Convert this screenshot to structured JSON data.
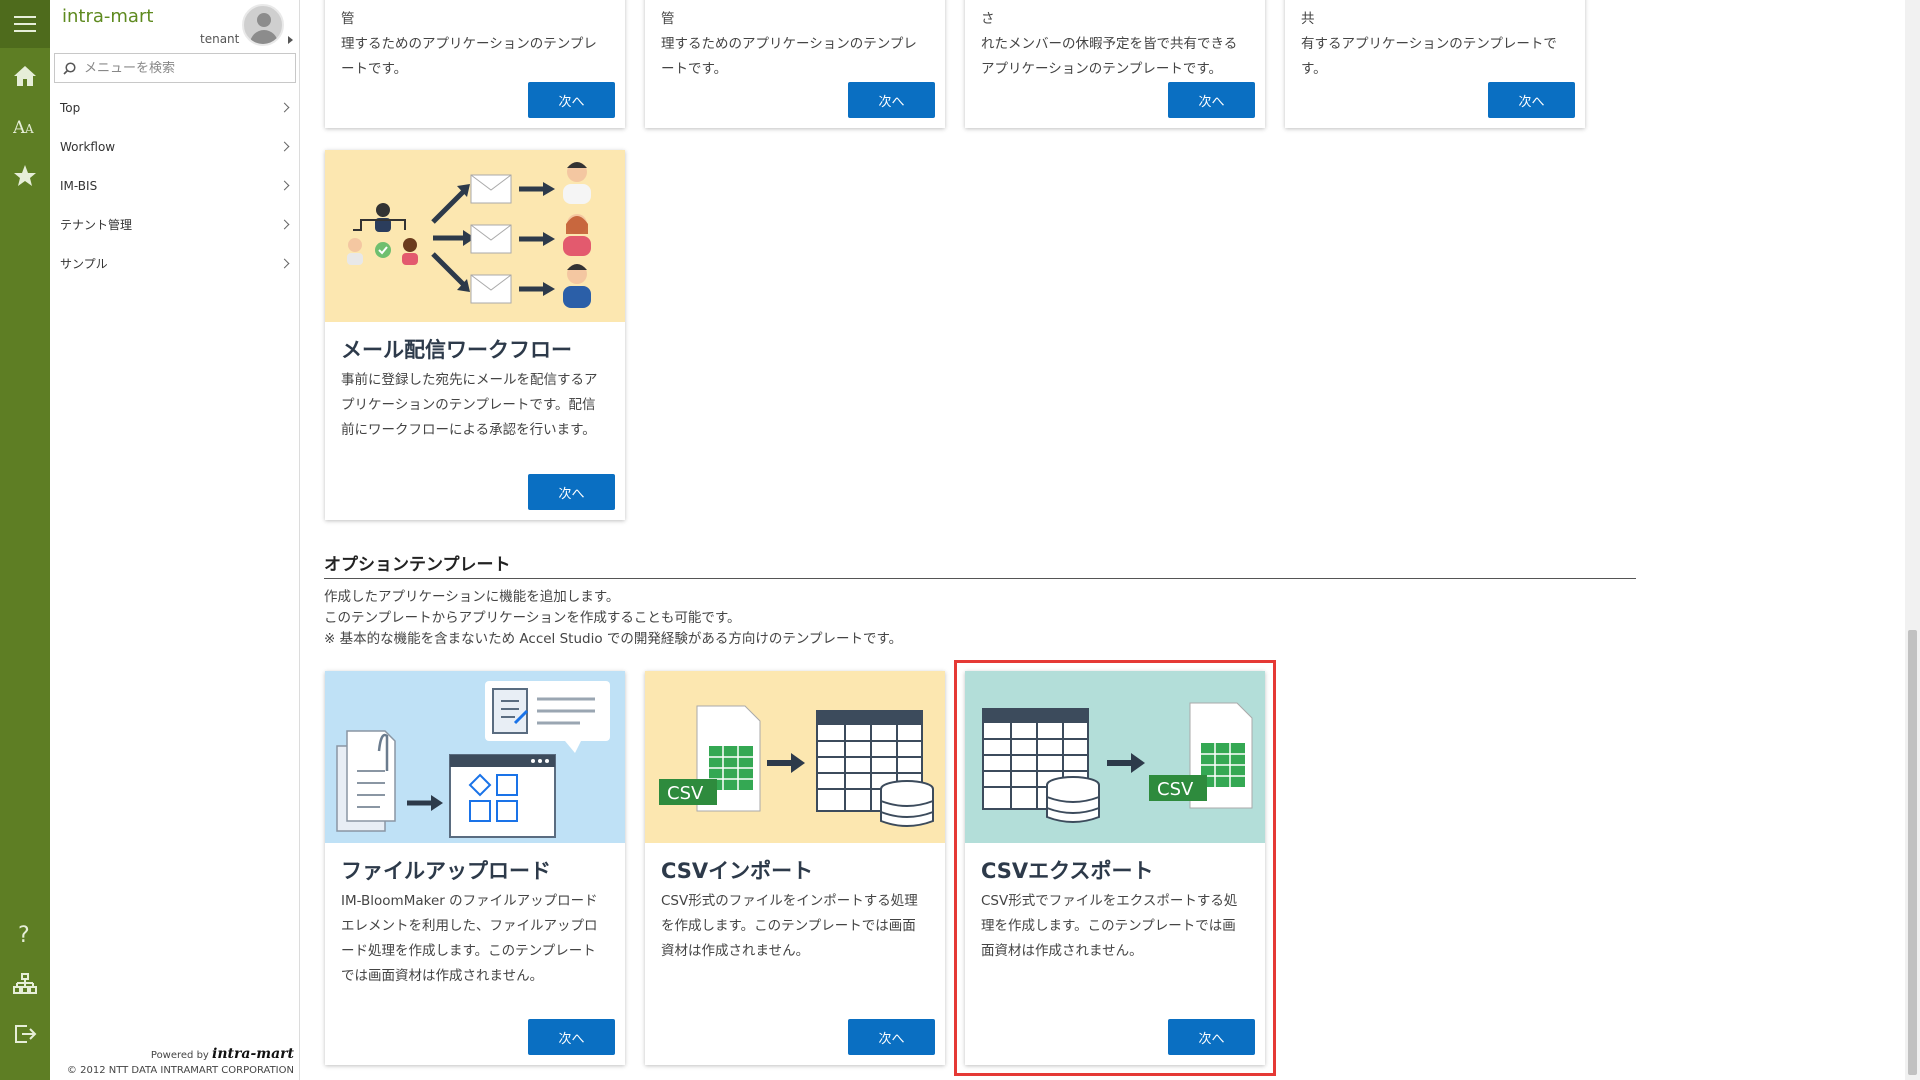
{
  "app": {
    "brand": "intra-mart",
    "tenant": "tenant"
  },
  "search": {
    "placeholder": "メニューを検索"
  },
  "sidebar": {
    "items": [
      {
        "label": "Top"
      },
      {
        "label": "Workflow"
      },
      {
        "label": "IM-BIS"
      },
      {
        "label": "テナント管理"
      },
      {
        "label": "サンプル"
      }
    ]
  },
  "footer": {
    "powered": "Powered by",
    "logo": "intra-mart",
    "copyright": "© 2012 NTT DATA INTRAMART CORPORATION"
  },
  "top_cards": [
    {
      "line1": "…顧客情報と担当者情報を管理して簡単に管",
      "line2": "理するためのアプリケーションのテンプレ",
      "line3": "ートです。",
      "button": "次へ"
    },
    {
      "line1": "…社内でよくある質問とその回答を簡単に管",
      "line2": "理するためのアプリケーションのテンプレ",
      "line3": "ートです。",
      "button": "次へ"
    },
    {
      "line1": "…ワークフローで休暇申請を承認し、承認さ",
      "line2": "れたメンバーの休暇予定を皆で共有できる",
      "line3": "アプリケーションのテンプレートです。",
      "button": "次へ"
    },
    {
      "line1": "…チームメンバーのプロフィールを載せて共",
      "line2": "有するアプリケーションのテンプレートで",
      "line3": "す。",
      "button": "次へ"
    }
  ],
  "mail_card": {
    "title": "メール配信ワークフロー",
    "line1": "事前に登録した宛先にメールを配信するア",
    "line2": "プリケーションのテンプレートです。配信",
    "line3": "前にワークフローによる承認を行います。",
    "button": "次へ"
  },
  "option_section": {
    "title": "オプションテンプレート",
    "desc1": "作成したアプリケーションに機能を追加します。",
    "desc2": "このテンプレートからアプリケーションを作成することも可能です。",
    "desc3": "※ 基本的な機能を含まないため Accel Studio での開発経験がある方向けのテンプレートです。"
  },
  "option_cards": [
    {
      "title": "ファイルアップロード",
      "line1": "IM-BloomMaker のファイルアップロード",
      "line2": "エレメントを利用した、ファイルアップロ",
      "line3": "ード処理を作成します。このテンプレート",
      "line4": "では画面資材は作成されません。",
      "button": "次へ"
    },
    {
      "title": "CSVインポート",
      "line1": "CSV形式のファイルをインポートする処理",
      "line2": "を作成します。このテンプレートでは画面",
      "line3": "資材は作成されません。",
      "button": "次へ"
    },
    {
      "title": "CSVエクスポート",
      "line1": "CSV形式でファイルをエクスポートする処",
      "line2": "理を作成します。このテンプレートでは画",
      "line3": "面資材は作成されません。",
      "button": "次へ"
    }
  ],
  "csv_label": "CSV",
  "colors": {
    "rail": "#5e7e24",
    "button": "#0a6fc2",
    "highlight": "#e53935",
    "brand": "#5e8a1f"
  }
}
